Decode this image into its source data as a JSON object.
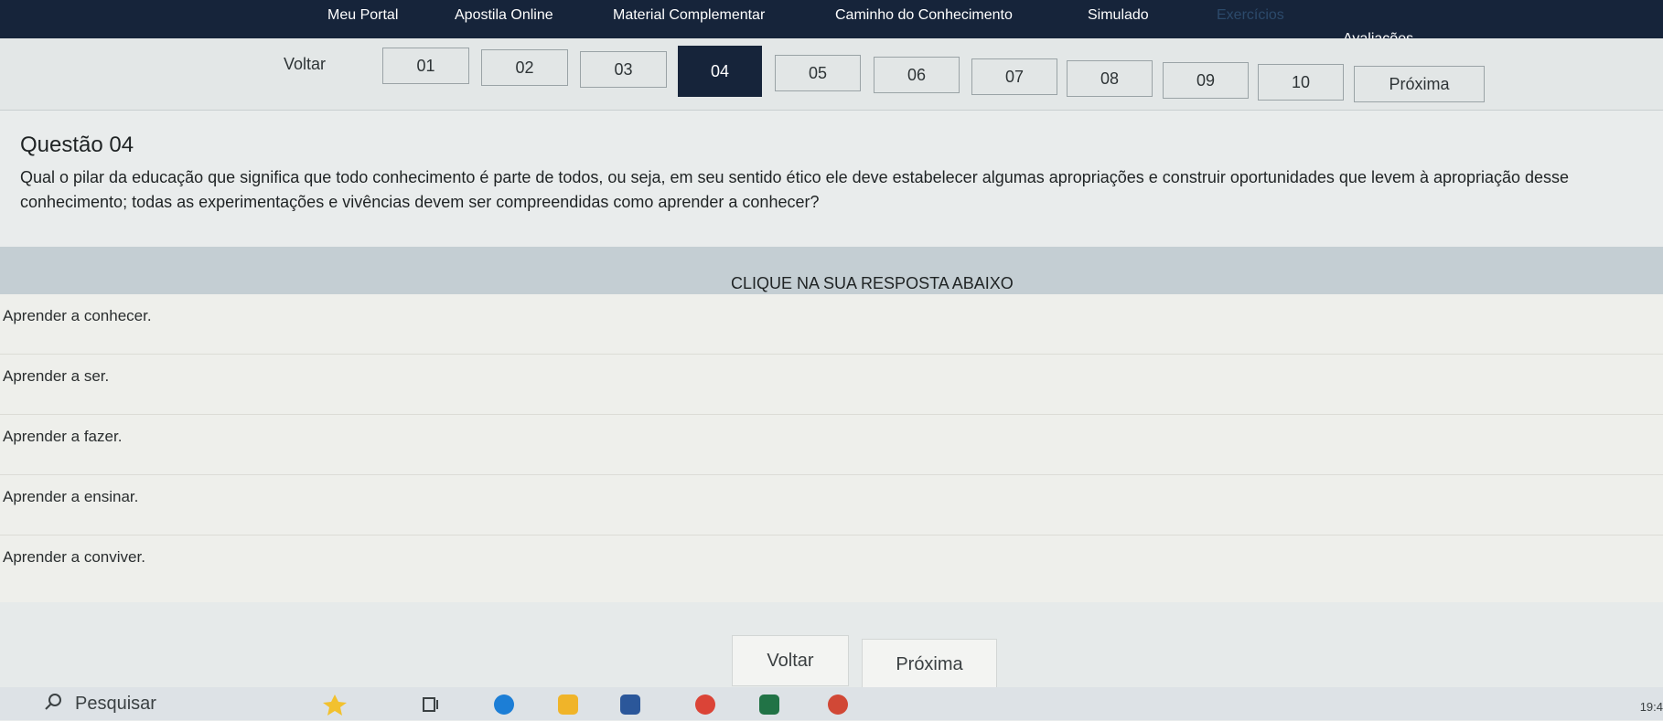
{
  "nav": {
    "items": [
      "Meu Portal",
      "Apostila Online",
      "Material Complementar",
      "Caminho do Conhecimento",
      "Simulado",
      "Exercícios",
      "Avaliações"
    ]
  },
  "pagination": {
    "back_label": "Voltar",
    "pages": [
      "01",
      "02",
      "03",
      "04",
      "05",
      "06",
      "07",
      "08",
      "09",
      "10"
    ],
    "current": "04",
    "next_label": "Próxima"
  },
  "question": {
    "title": "Questão 04",
    "text": "Qual o pilar da educação que significa que todo conhecimento é parte de todos, ou seja, em seu sentido ético ele deve estabelecer algumas apropriações e construir oportunidades que levem à apropriação desse conhecimento; todas as experimentações e vivências devem ser compreendidas como aprender a conhecer?"
  },
  "answers": {
    "header": "CLIQUE NA SUA RESPOSTA ABAIXO",
    "options": [
      "Aprender a conhecer.",
      "Aprender a ser.",
      "Aprender a fazer.",
      "Aprender a ensinar.",
      "Aprender a conviver."
    ]
  },
  "bottom": {
    "back_label": "Voltar",
    "next_label": "Próxima"
  },
  "taskbar": {
    "search_label": "Pesquisar",
    "clock": "19:4"
  },
  "colors": {
    "nav_bg": "#16243a",
    "active_page_bg": "#16243a",
    "banner_bg": "#c4ced3"
  }
}
